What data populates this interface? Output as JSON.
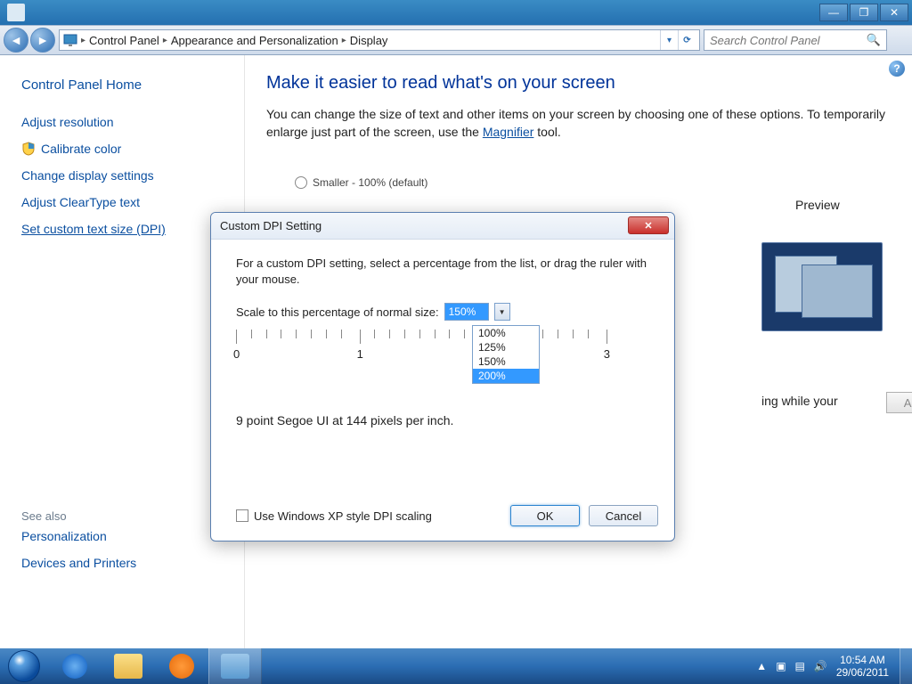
{
  "titlebar": {
    "min": "—",
    "max": "❐",
    "close": "✕"
  },
  "nav": {
    "back_glyph": "◄",
    "forward_glyph": "►",
    "crumb_icon": "▸",
    "crumbs": [
      "Control Panel",
      "Appearance and Personalization",
      "Display"
    ],
    "dropdown_glyph": "▾",
    "refresh_glyph": "↻",
    "search_placeholder": "Search Control Panel",
    "search_glyph": "🔍"
  },
  "sidebar": {
    "home": "Control Panel Home",
    "links": [
      "Adjust resolution",
      "Calibrate color",
      "Change display settings",
      "Adjust ClearType text",
      "Set custom text size (DPI)"
    ],
    "see_also": "See also",
    "see_also_links": [
      "Personalization",
      "Devices and Printers"
    ]
  },
  "main": {
    "title": "Make it easier to read what's on your screen",
    "paragraph_a": "You can change the size of text and other items on your screen by choosing one of these options. To temporarily enlarge just part of the screen, use the ",
    "magnifier": "Magnifier",
    "paragraph_b": " tool.",
    "radio_smaller": "Smaller - 100% (default)",
    "preview_label": "Preview",
    "apply_text_suffix": "ing while your",
    "apply_btn": "Apply",
    "help_glyph": "?"
  },
  "dialog": {
    "title": "Custom DPI Setting",
    "close_glyph": "✕",
    "instructions": "For a custom DPI setting, select a percentage from the list, or drag the ruler with your mouse.",
    "scale_label": "Scale to this percentage of normal size:",
    "combo_value": "150%",
    "combo_glyph": "▼",
    "options": [
      "100%",
      "125%",
      "150%",
      "200%"
    ],
    "selected_option": "200%",
    "ruler_labels": [
      "0",
      "1",
      "3"
    ],
    "sample": "9 point Segoe UI at 144 pixels per inch.",
    "checkbox": "Use Windows XP style DPI scaling",
    "ok": "OK",
    "cancel": "Cancel"
  },
  "taskbar": {
    "tray_glyphs": {
      "up": "▲",
      "flag": "▣",
      "net": "▤",
      "vol": "🔊"
    },
    "time": "10:54 AM",
    "date": "29/06/2011"
  }
}
